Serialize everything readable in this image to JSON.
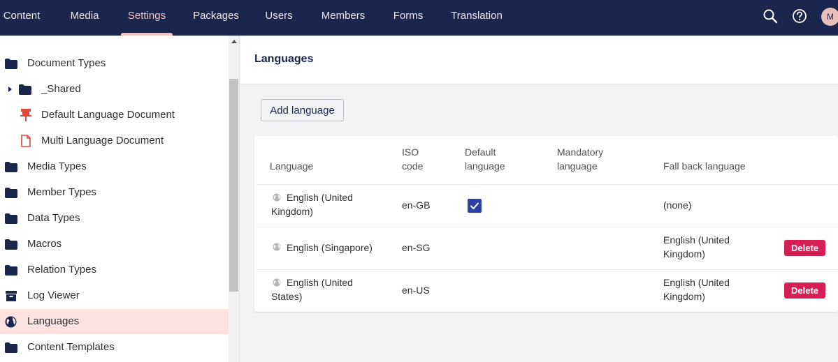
{
  "nav": {
    "sections": [
      "Content",
      "Media",
      "Settings",
      "Packages",
      "Users",
      "Members",
      "Forms",
      "Translation"
    ],
    "active": "Settings",
    "avatar_initial": "M",
    "colors": {
      "bar": "#1b264f",
      "active": "#f5c1bc"
    }
  },
  "tree": {
    "items": [
      {
        "label": "Document Types",
        "icon": "folder-icon"
      },
      {
        "label": "_Shared",
        "icon": "folder-icon",
        "expandable": true
      },
      {
        "label": "Default Language Document",
        "icon": "pushpin-icon"
      },
      {
        "label": "Multi Language Document",
        "icon": "document-icon"
      },
      {
        "label": "Media Types",
        "icon": "folder-icon"
      },
      {
        "label": "Member Types",
        "icon": "folder-icon"
      },
      {
        "label": "Data Types",
        "icon": "folder-icon"
      },
      {
        "label": "Macros",
        "icon": "folder-icon"
      },
      {
        "label": "Relation Types",
        "icon": "folder-icon"
      },
      {
        "label": "Log Viewer",
        "icon": "archive-icon"
      },
      {
        "label": "Languages",
        "icon": "globe-icon",
        "active": true
      },
      {
        "label": "Content Templates",
        "icon": "folder-icon"
      }
    ]
  },
  "main": {
    "title": "Languages",
    "add_label": "Add language",
    "table": {
      "headers": {
        "language": "Language",
        "iso_1": "ISO",
        "iso_2": "code",
        "default_1": "Default",
        "default_2": "language",
        "mandatory_1": "Mandatory",
        "mandatory_2": "language",
        "fallback": "Fall back language"
      },
      "rows": [
        {
          "lang_1": "English (United",
          "lang_2": "Kingdom)",
          "iso": "en-GB",
          "default": true,
          "fallback_1": "(none)",
          "fallback_2": "",
          "delete": ""
        },
        {
          "lang_1": "English (Singapore)",
          "lang_2": "",
          "iso": "en-SG",
          "default": false,
          "fallback_1": "English (United",
          "fallback_2": "Kingdom)",
          "delete": "Delete"
        },
        {
          "lang_1": "English (United",
          "lang_2": "States)",
          "iso": "en-US",
          "default": false,
          "fallback_1": "English (United",
          "fallback_2": "Kingdom)",
          "delete": "Delete"
        }
      ]
    }
  }
}
